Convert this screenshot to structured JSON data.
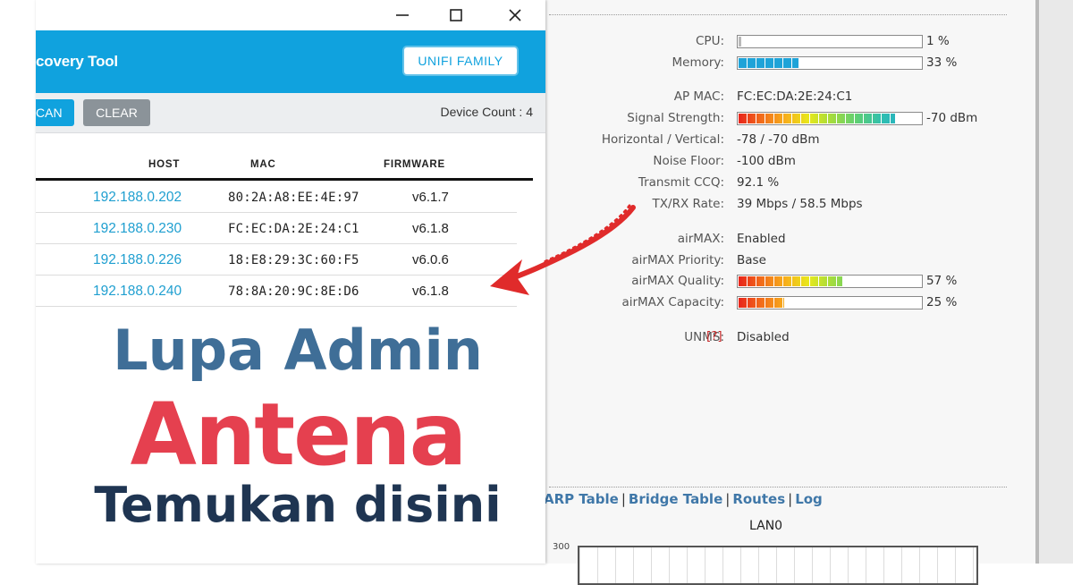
{
  "colors": {
    "accent_blue": "#10a2de",
    "link_blue": "#1f9fd0",
    "headline_blue": "#3f6e97",
    "headline_red": "#e5404f",
    "headline_navy": "#1f3552",
    "arrow_red": "#e02b2b"
  },
  "discovery_window": {
    "title": "covery Tool",
    "unifi_family_label": "UNIFI FAMILY",
    "scan_label": "CAN",
    "clear_label": "CLEAR",
    "device_count": "Device Count : 4",
    "columns": [
      "HOST",
      "MAC",
      "FIRMWARE"
    ],
    "rows": [
      {
        "host": "192.188.0.202",
        "mac": "80:2A:A8:EE:4E:97",
        "firmware": "v6.1.7"
      },
      {
        "host": "192.188.0.230",
        "mac": "FC:EC:DA:2E:24:C1",
        "firmware": "v6.1.8"
      },
      {
        "host": "192.188.0.226",
        "mac": "18:E8:29:3C:60:F5",
        "firmware": "v6.0.6"
      },
      {
        "host": "192.188.0.240",
        "mac": "78:8A:20:9C:8E:D6",
        "firmware": "v6.1.8"
      }
    ],
    "window_controls": [
      "minimize-icon",
      "maximize-icon",
      "close-icon"
    ]
  },
  "status": {
    "cpu": {
      "label": "CPU:",
      "value_text": "1 %",
      "percent": 1
    },
    "memory": {
      "label": "Memory:",
      "value_text": "33 %",
      "percent": 33
    },
    "ap_mac": {
      "label": "AP MAC:",
      "value": "FC:EC:DA:2E:24:C1"
    },
    "signal": {
      "label": "Signal Strength:",
      "value_text": "-70 dBm",
      "percent": 86
    },
    "horiz_vert": {
      "label": "Horizontal / Vertical:",
      "value": "-78 / -70 dBm"
    },
    "noise_floor": {
      "label": "Noise Floor:",
      "value": "-100 dBm"
    },
    "ccq": {
      "label": "Transmit CCQ:",
      "value": "92.1 %"
    },
    "txrx": {
      "label": "TX/RX Rate:",
      "value": "39 Mbps / 58.5 Mbps"
    },
    "airmax": {
      "label": "airMAX:",
      "value": "Enabled"
    },
    "airmax_priority": {
      "label": "airMAX Priority:",
      "value": "Base"
    },
    "airmax_quality": {
      "label": "airMAX Quality:",
      "value_text": "57 %",
      "percent": 57
    },
    "airmax_capacity": {
      "label": "airMAX Capacity:",
      "value_text": "25 %",
      "percent": 25
    },
    "unms": {
      "label": "UNMS:",
      "help": "[?]",
      "value": "Disabled"
    }
  },
  "tabs": [
    "ARP Table",
    "Bridge Table",
    "Routes",
    "Log"
  ],
  "tab_separator": "|",
  "graph": {
    "title": "LAN0",
    "y_tick": "300"
  },
  "headline": {
    "line1": "Lupa Admin",
    "line2": "Antena",
    "line3": "Temukan disini"
  }
}
